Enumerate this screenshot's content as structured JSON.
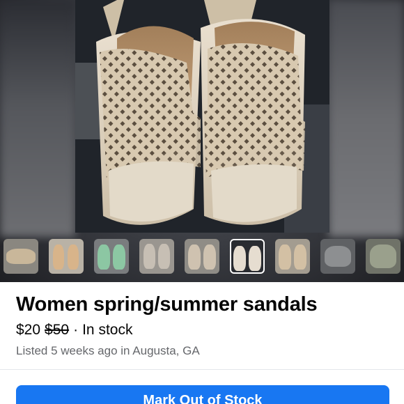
{
  "listing": {
    "title": "Women spring/summer sandals",
    "price": "$20",
    "original_price": "$50",
    "separator": "·",
    "availability": "In stock",
    "meta": "Listed 5 weeks ago in Augusta, GA"
  },
  "actions": {
    "primary_label": "Mark Out of Stock"
  },
  "gallery": {
    "thumbnails": [
      {
        "icon": "sandal-photo-1",
        "tone": "#c9b79a"
      },
      {
        "icon": "sandal-photo-2",
        "tone": "#d8b48a"
      },
      {
        "icon": "sandal-photo-3",
        "tone": "#8cc7a3"
      },
      {
        "icon": "sandal-photo-4",
        "tone": "#c7bfb4"
      },
      {
        "icon": "sandal-photo-5",
        "tone": "#cfc2b0"
      },
      {
        "icon": "sandal-photo-6",
        "tone": "#e6ddd0"
      },
      {
        "icon": "sandal-photo-7",
        "tone": "#d3c0a4"
      },
      {
        "icon": "sandal-photo-8",
        "tone": "#8d8f91"
      },
      {
        "icon": "sandal-photo-9",
        "tone": "#9aa08c"
      }
    ],
    "selected_index": 6
  },
  "colors": {
    "accent": "#1877f2",
    "text_primary": "#050505",
    "text_secondary": "#65676b"
  }
}
